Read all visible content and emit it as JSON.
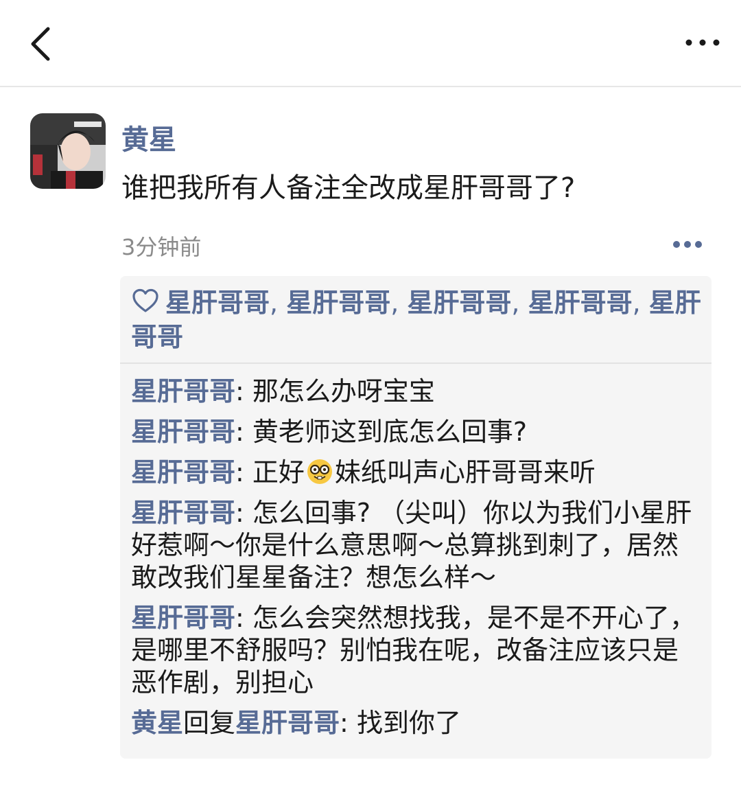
{
  "header": {
    "back_icon": "chevron-left-icon",
    "more_icon": "more-horizontal-icon"
  },
  "post": {
    "author": "黄星",
    "content": "谁把我所有人备注全改成星肝哥哥了?",
    "timestamp": "3分钟前",
    "more_icon": "more-dots-icon"
  },
  "likes": {
    "icon": "heart-outline-icon",
    "names": [
      "星肝哥哥",
      "星肝哥哥",
      "星肝哥哥",
      "星肝哥哥",
      "星肝哥哥"
    ],
    "separator": ", "
  },
  "comments": [
    {
      "author": "星肝哥哥",
      "text": "那怎么办呀宝宝"
    },
    {
      "author": "星肝哥哥",
      "text": "黄老师这到底怎么回事?"
    },
    {
      "author": "星肝哥哥",
      "text_before": "正好",
      "emoji": "nerd-face-emoji",
      "text_after": "妹纸叫声心肝哥哥来听"
    },
    {
      "author": "星肝哥哥",
      "text": "怎么回事? （尖叫）你以为我们小星肝好惹啊～你是什么意思啊～总算挑到刺了，居然敢改我们星星备注？想怎么样～"
    },
    {
      "author": "星肝哥哥",
      "text": "怎么会突然想找我，是不是不开心了，是哪里不舒服吗？别怕我在呢，改备注应该只是恶作剧，别担心"
    },
    {
      "author": "黄星",
      "reply_word": "回复",
      "reply_to": "星肝哥哥",
      "text": "找到你了"
    }
  ],
  "colors": {
    "link": "#576b95",
    "panel_bg": "#f5f5f5",
    "text": "#1a1a1a",
    "muted": "#8a8a8a"
  }
}
